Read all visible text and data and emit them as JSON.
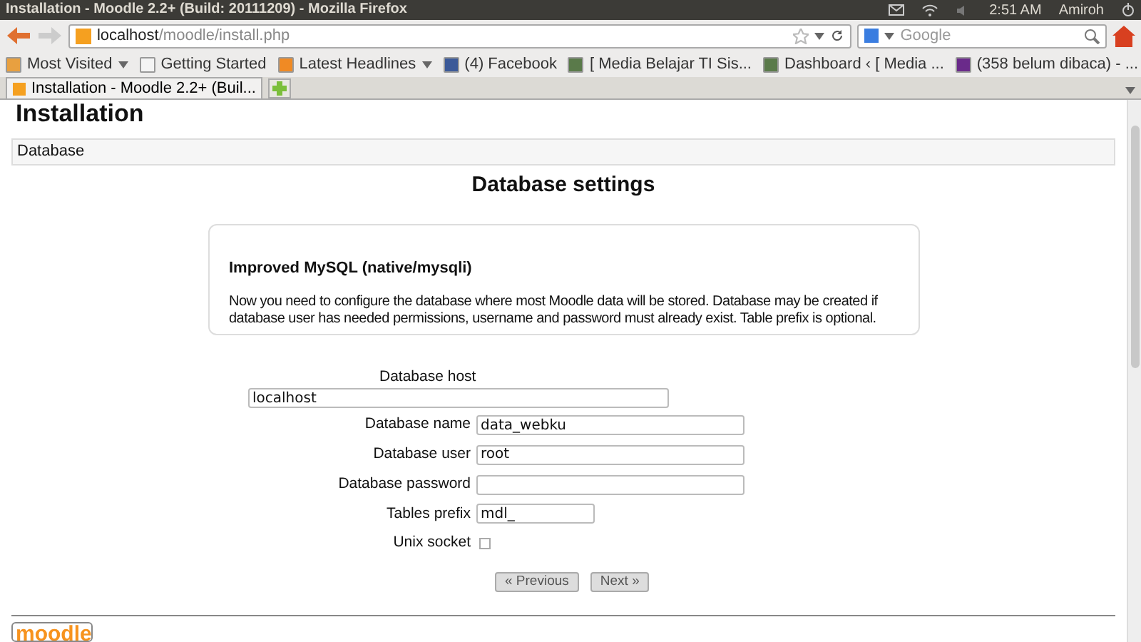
{
  "window": {
    "title": "Installation - Moodle 2.2+ (Build: 20111209) - Mozilla Firefox"
  },
  "panel": {
    "time": "2:51 AM",
    "user": "Amiroh"
  },
  "navbar": {
    "url_host": "localhost",
    "url_path": "/moodle/install.php",
    "search_placeholder": "Google"
  },
  "bookmarks": [
    {
      "label": "Most Visited",
      "menu": true
    },
    {
      "label": "Getting Started",
      "menu": false
    },
    {
      "label": "Latest Headlines",
      "menu": true
    },
    {
      "label": "(4) Facebook",
      "menu": false
    },
    {
      "label": "[ Media Belajar TI Sis...",
      "menu": false
    },
    {
      "label": "Dashboard ‹ [ Media ...",
      "menu": false
    },
    {
      "label": "(358 belum dibaca) - ...",
      "menu": false
    }
  ],
  "tabs": [
    {
      "label": "Installation - Moodle 2.2+ (Buil...",
      "selected": true
    }
  ],
  "page": {
    "heading": "Installation",
    "section": "Database",
    "title": "Database settings",
    "info_title": "Improved MySQL (native/mysqli)",
    "info_text": "Now you need to configure the database where most Moodle data will be stored. Database may be created if database user has needed permissions, username and password must already exist. Table prefix is optional.",
    "host": {
      "label": "Database host",
      "value": "localhost"
    },
    "fields": [
      {
        "kind": "text",
        "label": "Database name",
        "value": "data_webku"
      },
      {
        "kind": "text",
        "label": "Database user",
        "value": "root"
      },
      {
        "kind": "text",
        "label": "Database password"
      },
      {
        "kind": "short",
        "label": "Tables prefix",
        "value": "mdl_"
      },
      {
        "kind": "checkbox",
        "label": "Unix socket",
        "checked": false
      }
    ],
    "buttons": [
      "« Previous",
      "Next »"
    ],
    "logo": "moodle"
  }
}
